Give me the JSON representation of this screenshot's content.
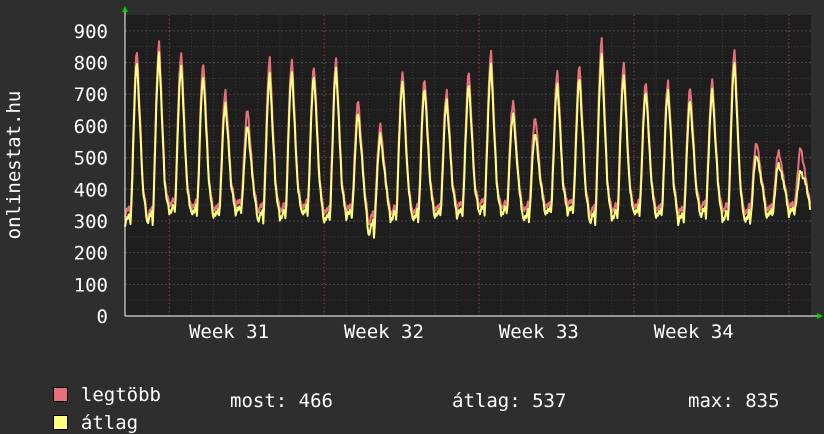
{
  "colors": {
    "background": "#2e2e2e",
    "plot_background": "#1e1e1e",
    "grid": "#474747",
    "grid_minor": "#3a3a3a",
    "vertical_grid": "#a0403a",
    "axis_arrow": "#00d000",
    "series_max": "#e8707a",
    "series_avg": "#ffff80"
  },
  "legend": {
    "max_label": "legtöbb",
    "avg_label": "átlag"
  },
  "stats": {
    "now": "most: 466",
    "avg": "átlag: 537",
    "max": "max: 835"
  },
  "chart_data": {
    "type": "line",
    "ylabel": "onlinestat.hu",
    "ylim": [
      0,
      950
    ],
    "yticks": [
      0,
      100,
      200,
      300,
      400,
      500,
      600,
      700,
      800,
      900
    ],
    "x_labels": [
      "Week 31",
      "Week 32",
      "Week 33",
      "Week 34"
    ],
    "days": 31,
    "grid": true,
    "series": [
      {
        "name": "legtöbb",
        "color": "#e8707a",
        "daily_peaks": [
          835,
          860,
          830,
          800,
          710,
          650,
          810,
          810,
          790,
          810,
          680,
          600,
          770,
          750,
          710,
          770,
          830,
          680,
          630,
          770,
          790,
          870,
          800,
          740,
          740,
          720,
          740,
          840,
          550,
          520,
          530
        ],
        "daily_troughs": [
          320,
          310,
          350,
          340,
          330,
          350,
          330,
          330,
          340,
          320,
          330,
          290,
          320,
          320,
          330,
          340,
          350,
          340,
          330,
          340,
          350,
          320,
          330,
          340,
          330,
          320,
          340,
          330,
          320,
          330,
          340
        ]
      },
      {
        "name": "átlag",
        "color": "#ffff80",
        "daily_peaks": [
          810,
          835,
          800,
          770,
          680,
          610,
          770,
          780,
          770,
          790,
          650,
          580,
          750,
          730,
          690,
          740,
          800,
          650,
          590,
          740,
          760,
          830,
          770,
          720,
          720,
          690,
          720,
          810,
          520,
          490,
          466
        ],
        "daily_troughs": [
          300,
          305,
          335,
          330,
          320,
          335,
          310,
          315,
          330,
          305,
          320,
          265,
          310,
          310,
          320,
          325,
          335,
          330,
          310,
          330,
          335,
          305,
          315,
          330,
          320,
          305,
          325,
          310,
          305,
          320,
          330
        ]
      }
    ]
  }
}
